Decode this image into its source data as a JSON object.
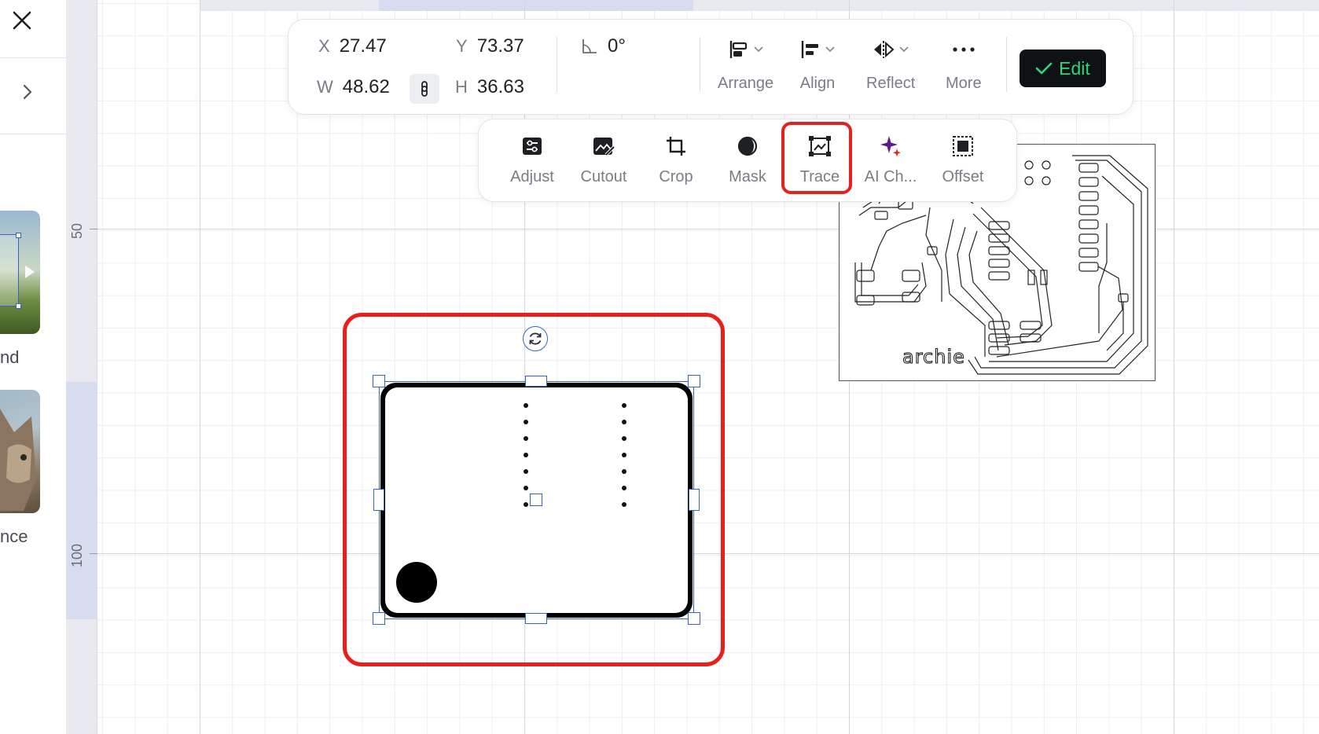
{
  "left_panel": {
    "close_icon": "close-icon",
    "expand_icon": "chevron-right-icon",
    "items": [
      {
        "label": "nd"
      },
      {
        "label": "nce"
      }
    ]
  },
  "ruler": {
    "v_labels": [
      "50",
      "100"
    ]
  },
  "toolbar": {
    "x_label": "X",
    "x_value": "27.47",
    "y_label": "Y",
    "y_value": "73.37",
    "w_label": "W",
    "w_value": "48.62",
    "h_label": "H",
    "h_value": "36.63",
    "angle_value": "0°",
    "arrange_label": "Arrange",
    "align_label": "Align",
    "reflect_label": "Reflect",
    "more_label": "More",
    "edit_label": "Edit"
  },
  "image_tools": {
    "adjust_label": "Adjust",
    "cutout_label": "Cutout",
    "crop_label": "Crop",
    "mask_label": "Mask",
    "trace_label": "Trace",
    "ai_label": "AI Ch...",
    "offset_label": "Offset"
  },
  "pcb": {
    "label": "archie"
  },
  "colors": {
    "accent_red": "#e8201d",
    "selection_blue": "#3a61c4",
    "edit_green": "#2fd67a",
    "edit_bg": "#0f1214"
  }
}
